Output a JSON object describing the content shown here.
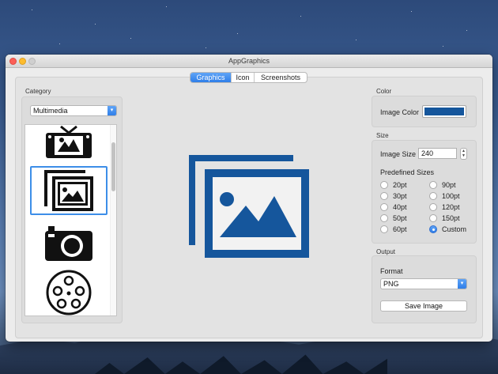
{
  "window": {
    "title": "AppGraphics"
  },
  "tabs": [
    {
      "label": "Graphics",
      "active": true
    },
    {
      "label": "Icon",
      "active": false
    },
    {
      "label": "Screenshots",
      "active": false
    }
  ],
  "category": {
    "section_label": "Category",
    "selected": "Multimedia",
    "items": [
      {
        "icon": "tv-photo-icon"
      },
      {
        "icon": "photo-stack-icon",
        "selected": true
      },
      {
        "icon": "camera-icon"
      },
      {
        "icon": "film-reel-icon"
      }
    ]
  },
  "color": {
    "section_label": "Color",
    "image_color_label": "Image Color",
    "image_color": "#15569c"
  },
  "size": {
    "section_label": "Size",
    "image_size_label": "Image Size",
    "image_size_value": "240",
    "predefined_label": "Predefined Sizes",
    "options": [
      "20pt",
      "30pt",
      "40pt",
      "50pt",
      "60pt",
      "90pt",
      "100pt",
      "120pt",
      "150pt",
      "Custom"
    ],
    "selected": "Custom"
  },
  "output": {
    "section_label": "Output",
    "format_label": "Format",
    "format_value": "PNG",
    "save_label": "Save Image"
  },
  "colors": {
    "accent": "#2f7ee8",
    "preview_icon": "#15569c"
  }
}
